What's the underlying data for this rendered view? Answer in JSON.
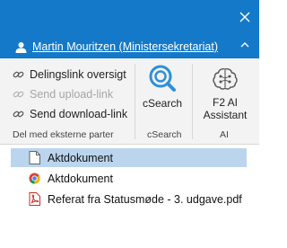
{
  "header": {
    "user_name": "Martin Mouritzen (Ministersekretariat)"
  },
  "ribbon": {
    "share_group": {
      "items": [
        {
          "label": "Delingslink oversigt",
          "enabled": true
        },
        {
          "label": "Send upload-link",
          "enabled": false
        },
        {
          "label": "Send download-link",
          "enabled": true
        }
      ],
      "group_label": "Del med eksterne parter"
    },
    "csearch_group": {
      "button_label": "cSearch",
      "group_label": "cSearch"
    },
    "ai_group": {
      "button_label_line1": "F2 AI",
      "button_label_line2": "Assistant",
      "group_label": "AI"
    }
  },
  "documents": [
    {
      "name": "Aktdokument",
      "icon": "blank-document-icon",
      "selected": true
    },
    {
      "name": "Aktdokument",
      "icon": "chrome-document-icon",
      "selected": false
    },
    {
      "name": "Referat fra Statusmøde - 3. udgave.pdf",
      "icon": "pdf-icon",
      "selected": false
    }
  ],
  "colors": {
    "titlebar": "#1479c9",
    "selection": "#bcd5ee",
    "ribbon_bg": "#f3f3f3",
    "disabled_text": "#a6a6a6"
  }
}
